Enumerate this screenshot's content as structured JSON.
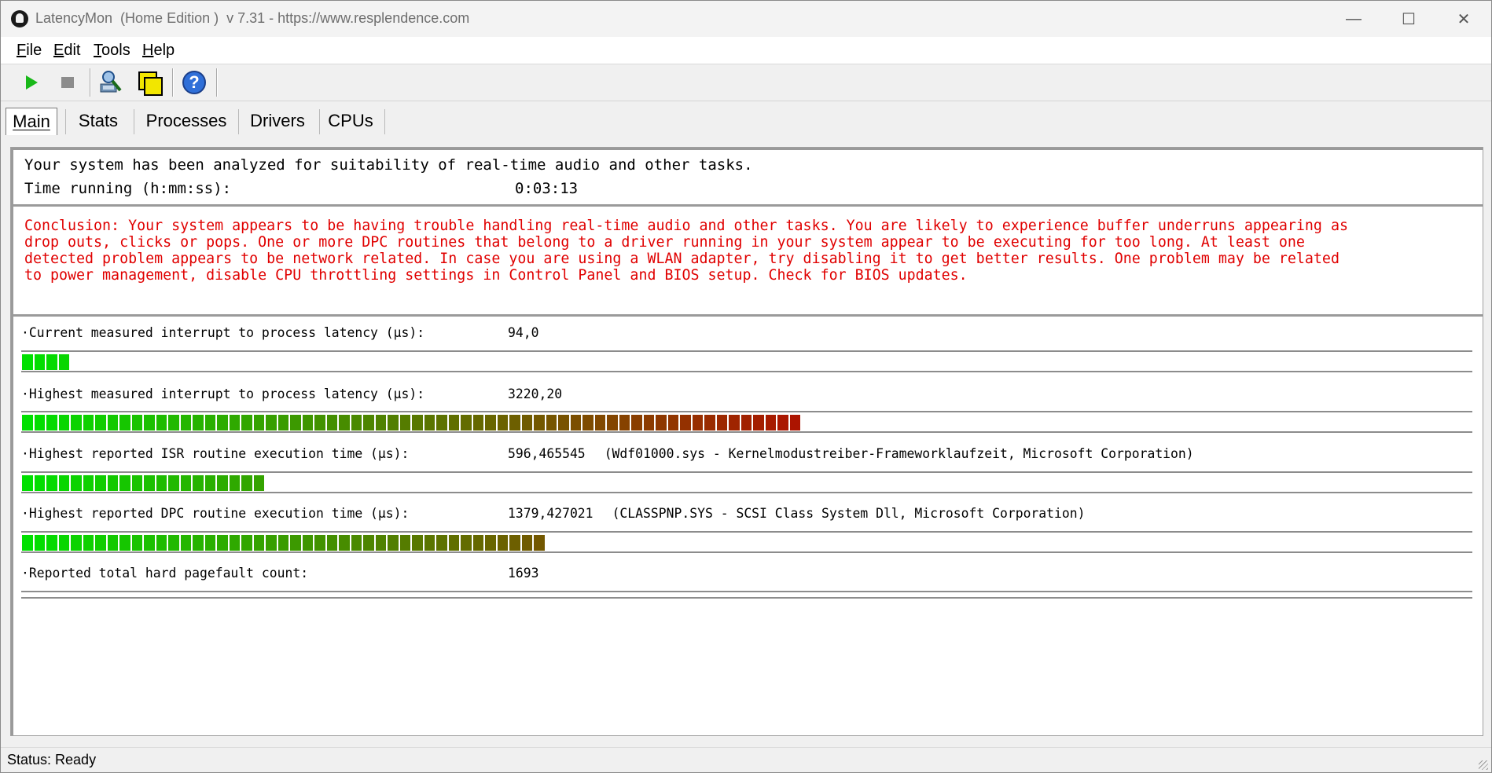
{
  "window": {
    "title": "LatencyMon  (Home Edition )  v 7.31 - https://www.resplendence.com",
    "minimize_glyph": "—",
    "maximize_glyph": "☐",
    "close_glyph": "✕"
  },
  "menu": [
    {
      "label": "File",
      "accel": "F"
    },
    {
      "label": "Edit",
      "accel": "E"
    },
    {
      "label": "Tools",
      "accel": "T"
    },
    {
      "label": "Help",
      "accel": "H"
    }
  ],
  "toolbar": {
    "icons": [
      "play-icon",
      "stop-icon",
      "driver-properties-icon",
      "window-icon",
      "help-icon"
    ],
    "help_glyph": "?"
  },
  "tabs": [
    "Main",
    "Stats",
    "Processes",
    "Drivers",
    "CPUs"
  ],
  "active_tab": "Main",
  "summary": {
    "analysis": "Your system has been analyzed for suitability of real-time audio and other tasks.",
    "time_label": "Time running (h:mm:ss):",
    "time_value": "0:03:13"
  },
  "conclusion": "Conclusion: Your system appears to be having trouble handling real-time audio and other tasks. You are likely to experience buffer underruns appearing as\ndrop outs, clicks or pops. One or more DPC routines that belong to a driver running in your system appear to be executing for too long. At least one\ndetected problem appears to be network related. In case you are using a WLAN adapter, try disabling it to get better results. One problem may be related\nto power management, disable CPU throttling settings in Control Panel and BIOS setup. Check for BIOS updates.",
  "metrics": [
    {
      "label": "·Current measured interrupt to process latency (µs):",
      "value": "94,0",
      "detail": "",
      "bar_level": 0.031
    },
    {
      "label": "·Highest measured interrupt to process latency (µs):",
      "value": "3220,20",
      "detail": "",
      "bar_level": 0.536
    },
    {
      "label": "·Highest reported ISR routine execution time (µs):",
      "value": "596,465545",
      "detail": "(Wdf01000.sys - Kernelmodustreiber-Frameworklaufzeit, Microsoft Corporation)",
      "bar_level": 0.165
    },
    {
      "label": "·Highest reported DPC routine execution time (µs):",
      "value": "1379,427021",
      "detail": "(CLASSPNP.SYS - SCSI Class System Dll, Microsoft Corporation)",
      "bar_level": 0.36
    },
    {
      "label": "·Reported total hard pagefault count:",
      "value": "1693",
      "detail": "",
      "bar_level": null
    }
  ],
  "colors": {
    "conclusion_text": "#e00000",
    "bar_green": "#00e000",
    "bar_red": "#b01000"
  },
  "status": "Status: Ready"
}
